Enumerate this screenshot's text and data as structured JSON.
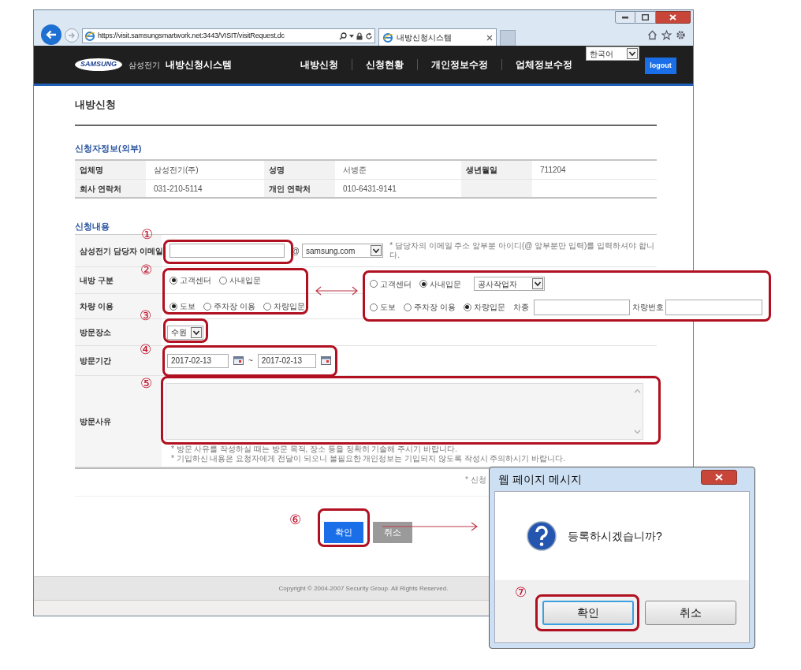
{
  "browser": {
    "address": "https://visit.samsungsmartwork.net:3443/VISIT/visitRequest.dc",
    "tabs": [
      {
        "title": "내방신청시스템",
        "selected": true
      }
    ]
  },
  "header": {
    "logo": "SAMSUNG",
    "brand": "삼성전기",
    "system": "내방신청시스템",
    "nav": [
      "내방신청",
      "신청현황",
      "개인정보수정",
      "업체정보수정"
    ],
    "language": "한국어",
    "logout": "logout"
  },
  "page_title": "내방신청",
  "applicant": {
    "heading": "신청자정보(외부)",
    "rows": [
      [
        {
          "label": "업체명",
          "value": "삼성전기(주)"
        },
        {
          "label": "성명",
          "value": "서병준"
        },
        {
          "label": "생년월일",
          "value": "711204"
        }
      ],
      [
        {
          "label": "회사 연락처",
          "value": "031-210-5114"
        },
        {
          "label": "개인 연락처",
          "value": "010-6431-9141"
        }
      ]
    ]
  },
  "request": {
    "heading": "신청내용",
    "email": {
      "label": "삼성전기 담당자 이메일",
      "at": "@",
      "domain": "samsung.com",
      "note": "* 담당자의 이메일 주소 앞부분 아이디(@ 앞부분만 입력)를 입력하셔야 합니다."
    },
    "visit_type": {
      "label": "내방 구분",
      "options": [
        {
          "label": "고객센터",
          "selected": true
        },
        {
          "label": "사내입문",
          "selected": false
        }
      ]
    },
    "vehicle": {
      "label": "차량 이용",
      "options": [
        {
          "label": "도보",
          "selected": true
        },
        {
          "label": "주차장 이용",
          "selected": false
        },
        {
          "label": "차량입문",
          "selected": false
        }
      ]
    },
    "place": {
      "label": "방문장소",
      "value": "수원"
    },
    "period": {
      "label": "방문기간",
      "from": "2017-02-13",
      "separator": "~",
      "to": "2017-02-13"
    },
    "reason": {
      "label": "방문사유",
      "notes": [
        "* 방문 사유를 작성하실 때는 방문 목적, 장소 등을 정확히 기술해 주시기 바랍니다.",
        "* 기입하신 내용은 요청자에게 전달이 되오니 불필요한 개인정보는 기입되지 않도록 작성시 주의하시기 바랍니다."
      ]
    },
    "footnote": "* 신청",
    "buttons": [
      {
        "label": "확인",
        "kind": "primary"
      },
      {
        "label": "취소",
        "kind": "secondary"
      }
    ]
  },
  "alternative": {
    "visit_type": [
      {
        "label": "고객센터",
        "selected": false
      },
      {
        "label": "사내입문",
        "selected": true
      }
    ],
    "worker_type": "공사작업자",
    "vehicle": [
      {
        "label": "도보",
        "selected": false
      },
      {
        "label": "주차장 이용",
        "selected": false
      },
      {
        "label": "차량입문",
        "selected": true
      }
    ],
    "car_model_label": "차종",
    "plate_label": "차량번호"
  },
  "copyright": "Copyright © 2004-2007 Security Group. All Rights Reserved.",
  "dialog": {
    "title": "웹 페이지 메시지",
    "message": "등록하시겠습니까?",
    "buttons": [
      {
        "label": "확인",
        "selected": true
      },
      {
        "label": "취소",
        "selected": false
      }
    ]
  },
  "markers": [
    "①",
    "②",
    "③",
    "④",
    "⑤",
    "⑥",
    "⑦"
  ]
}
